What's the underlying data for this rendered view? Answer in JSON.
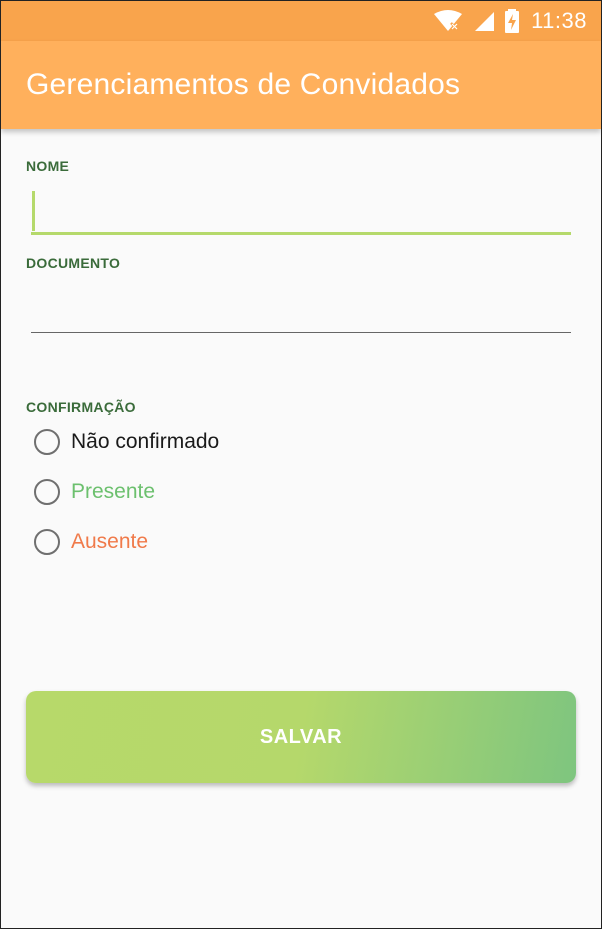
{
  "status_bar": {
    "time": "11:38",
    "icons": [
      "wifi-off-icon",
      "cell-signal-icon",
      "battery-charging-icon"
    ]
  },
  "app_bar": {
    "title": "Gerenciamentos de Convidados"
  },
  "form": {
    "name_label": "NOME",
    "name_value": "",
    "document_label": "DOCUMENTO",
    "document_value": "",
    "confirmation_label": "CONFIRMAÇÃO",
    "options": [
      {
        "label": "Não confirmado",
        "color": "#1a1a1a",
        "selected": false
      },
      {
        "label": "Presente",
        "color": "#6cc06e",
        "selected": false
      },
      {
        "label": "Ausente",
        "color": "#f07a4a",
        "selected": false
      }
    ],
    "save_label": "SALVAR"
  },
  "colors": {
    "status_bar": "#f9a44c",
    "app_bar": "#ffb05c",
    "label": "#3a6b3a",
    "accent_line": "#b5d96b",
    "button_gradient_start": "#b7d96a",
    "button_gradient_end": "#7ec57f"
  }
}
